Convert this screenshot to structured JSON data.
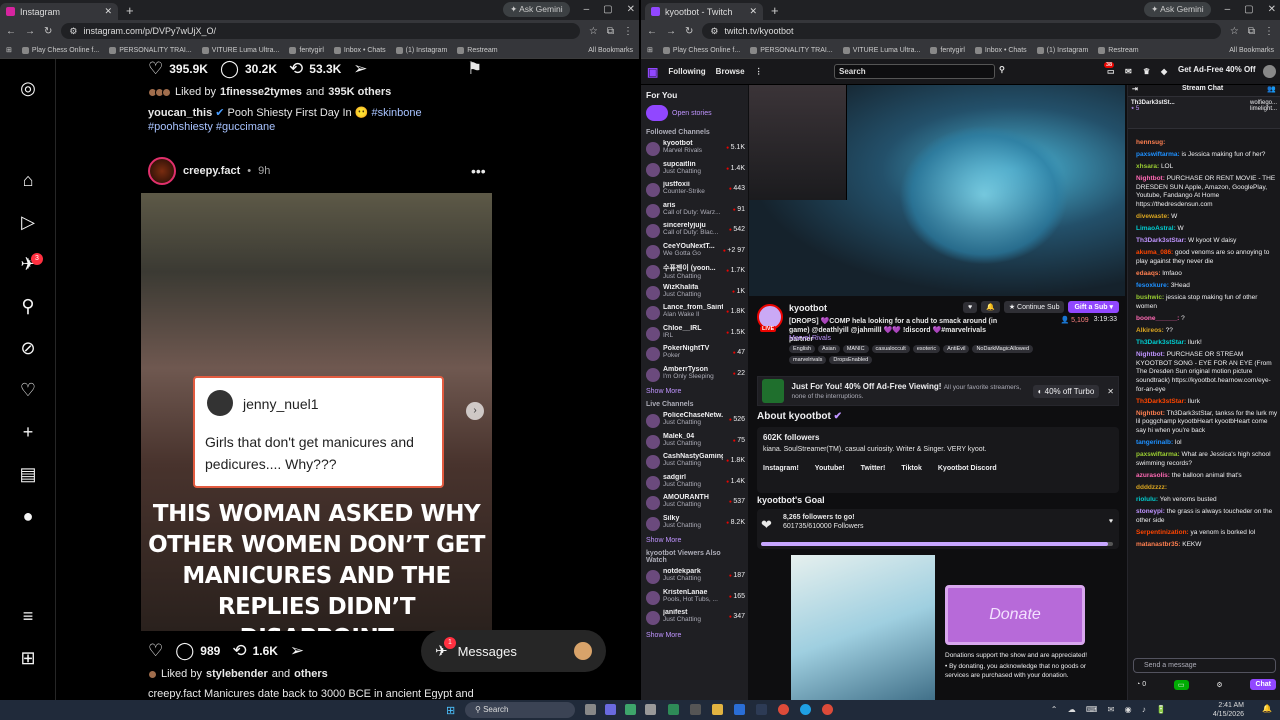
{
  "left": {
    "tab": "Instagram",
    "url": "instagram.com/p/DVPy7wUjX_O/",
    "gemini": "Ask Gemini",
    "bookmarks": [
      "Play Chess Online f...",
      "PERSONALITY TRAI...",
      "VITURE Luma Ultra...",
      "fentygirl",
      "Inbox • Chats",
      "(1) Instagram",
      "Restream"
    ],
    "all_bookmarks": "All Bookmarks",
    "nav_badge": "3",
    "post1": {
      "likes": "395.9K",
      "comments": "30.2K",
      "reposts": "53.3K",
      "liked_by_user": "1finesse2tymes",
      "liked_by_others": "395K others",
      "caption_user": "youcan_this",
      "caption_text": "Pooh Shiesty First Day In",
      "tags": [
        "#skinbone",
        "#poohshiesty",
        "#guccimane"
      ]
    },
    "post2": {
      "user": "creepy.fact",
      "time": "9h",
      "overlay_user": "jenny_nuel1",
      "overlay_text": "Girls that don't get manicures and pedicures.... Why???",
      "headline": "THIS WOMAN ASKED WHY OTHER WOMEN DON’T GET MANICURES AND THE REPLIES DIDN’T DISAPPOINT",
      "comments": "989",
      "reposts": "1.6K",
      "liked_by_user": "stylebender",
      "liked_by_others": "others",
      "caption": "creepy.fact Manicures date back to 3000 BCE in ancient Egypt and"
    },
    "messages_label": "Messages",
    "messages_badge": "1"
  },
  "right": {
    "tab": "kyootbot - Twitch",
    "url": "twitch.tv/kyootbot",
    "gemini": "Ask Gemini",
    "bookmarks": [
      "Play Chess Online f...",
      "PERSONALITY TRAI...",
      "VITURE Luma Ultra...",
      "fentygirl",
      "Inbox • Chats",
      "(1) Instagram",
      "Restream"
    ],
    "all_bookmarks": "All Bookmarks",
    "nav": {
      "following": "Following",
      "browse": "Browse",
      "search_placeholder": "Search",
      "notif": "38",
      "get_ad_free": "Get Ad-Free 40% Off"
    },
    "sidebar": {
      "for_you": "For You",
      "open_stories": "Open stories",
      "followed_title": "Followed Channels",
      "followed": [
        {
          "name": "kyootbot",
          "game": "Marvel Rivals",
          "viewers": "5.1K"
        },
        {
          "name": "supcaitlin",
          "game": "Just Chatting",
          "viewers": "1.4K"
        },
        {
          "name": "justfoxii",
          "game": "Counter-Strike",
          "viewers": "443"
        },
        {
          "name": "aris",
          "game": "Call of Duty: Warz...",
          "viewers": "91"
        },
        {
          "name": "sincerelyjuju",
          "game": "Call of Duty: Blac...",
          "viewers": "542"
        },
        {
          "name": "CeeYOuNextT...",
          "game": "We Gotta Go",
          "viewers": "+2 97"
        },
        {
          "name": "수퓨젠이 (yoon...",
          "game": "Just Chatting",
          "viewers": "1.7K"
        },
        {
          "name": "WizKhalifa",
          "game": "Just Chatting",
          "viewers": "1K"
        },
        {
          "name": "Lance_from_Saints",
          "game": "Alan Wake II",
          "viewers": "1.8K"
        },
        {
          "name": "Chloe__IRL",
          "game": "IRL",
          "viewers": "1.5K"
        },
        {
          "name": "PokerNightTV",
          "game": "Poker",
          "viewers": "47"
        },
        {
          "name": "AmberrTyson",
          "game": "I'm Only Sleeping",
          "viewers": "22"
        }
      ],
      "show_more": "Show More",
      "live_title": "Live Channels",
      "live": [
        {
          "name": "PoliceChaseNetw...",
          "game": "Just Chatting",
          "viewers": "526"
        },
        {
          "name": "Malek_04",
          "game": "Just Chatting",
          "viewers": "75"
        },
        {
          "name": "CashNastyGaming",
          "game": "Just Chatting",
          "viewers": "1.8K"
        },
        {
          "name": "sadgirl",
          "game": "Just Chatting",
          "viewers": "1.4K"
        },
        {
          "name": "AMOURANTH",
          "game": "Just Chatting",
          "viewers": "537"
        },
        {
          "name": "Silky",
          "game": "Just Chatting",
          "viewers": "8.2K"
        }
      ],
      "also_title": "kyootbot Viewers Also Watch",
      "also": [
        {
          "name": "notdekpark",
          "game": "Just Chatting",
          "viewers": "187"
        },
        {
          "name": "KristenLanae",
          "game": "Pools, Hot Tubs, ...",
          "viewers": "165"
        },
        {
          "name": "janifest",
          "game": "Just Chatting",
          "viewers": "347"
        }
      ]
    },
    "stream": {
      "live": "LIVE",
      "name": "kyootbot",
      "title": "[DROPS] 💜COMP hela looking for a chud to smack around (in game) @deathlyill @jahmilll 💜💜 !discord 💜#marvelrivals partner",
      "game": "Marvel Rivals",
      "tags": [
        "English",
        "Asian",
        "MANIC",
        "casualoccult",
        "esoteric",
        "AntiEvil",
        "NoDarkMagicAllowed",
        "marvelrivals",
        "DropsEnabled"
      ],
      "continue_sub": "Continue Sub",
      "gift_sub": "Gift a Sub",
      "viewers": "5,109",
      "uptime": "3:19:33",
      "promo_title": "Just For You! 40% Off Ad-Free Viewing!",
      "promo_sub": "All your favorite streamers, none of the interruptions.",
      "promo_btn": "40% off Turbo",
      "about_title": "About kyootbot",
      "followers": "602K followers",
      "bio": "kiana. SoulStreamer(TM). casual curiosity. Writer & Singer. VERY kyoot.",
      "socials": [
        "Instagram!",
        "Youtube!",
        "Twitter!",
        "Tiktok",
        "Kyootbot Discord"
      ],
      "goal_title": "kyootbot's Goal",
      "goal_line": "8,265 followers to go!",
      "goal_count": "601735/610000 Followers",
      "goal_fraction": 0.9865,
      "donate_label": "Donate",
      "donate_text": "Donations support the show and are appreciated!",
      "donate_bullet": "By donating, you acknowledge that no goods or services are purchased with your donation."
    },
    "chat": {
      "header": "Stream Chat",
      "hype_user": "Th3Dark3stSt...",
      "hype_count": "5",
      "hype_users": [
        "wolfiego...",
        "limelight..."
      ],
      "messages": [
        {
          "user": "hennsug:",
          "text": ""
        },
        {
          "user": "paxswiftarma:",
          "text": "is Jessica making fun of her?"
        },
        {
          "user": "xhsara:",
          "text": "LOL"
        },
        {
          "user": "Nightbot:",
          "text": "PURCHASE OR RENT MOVIE - THE DRESDEN SUN Apple, Amazon, GooglePlay, Youtube, Fandango At Home https://thedresdensun.com"
        },
        {
          "user": "divewaste:",
          "text": "W"
        },
        {
          "user": "LimaoAstral:",
          "text": "W"
        },
        {
          "user": "Th3Dark3stStar:",
          "text": "W kyoot W daisy"
        },
        {
          "user": "akuma_086:",
          "text": "good venoms are so annoying to play against they never die"
        },
        {
          "user": "edaaqs:",
          "text": "lmfaoo"
        },
        {
          "user": "fesoxkure:",
          "text": "3Head"
        },
        {
          "user": "bushwic:",
          "text": "jessica stop making fun of other women"
        },
        {
          "user": "boone______:",
          "text": "?"
        },
        {
          "user": "Alkireos:",
          "text": "??"
        },
        {
          "user": "Th3Dark3stStar:",
          "text": "llurk!"
        },
        {
          "user": "Nightbot:",
          "text": "PURCHASE OR STREAM KYOOTBOT SONG - EYE FOR AN EYE (From The Dresden Sun original motion picture soundtrack) https://kyootbot.hearnow.com/eye-for-an-eye"
        },
        {
          "user": "Th3Dark3stStar:",
          "text": "llurk"
        },
        {
          "user": "Nightbot:",
          "text": "Th3Dark3stStar, tankss for the lurk my lil poggchamp kyootbHeart kyootbHeart come say hi when you're back"
        },
        {
          "user": "tangerinalb:",
          "text": "lol"
        },
        {
          "user": "paxswiftarma:",
          "text": "What are Jessica's high school swimming records?"
        },
        {
          "user": "azurasolis:",
          "text": "the balloon animal that's"
        },
        {
          "user": "ddddzzzz:",
          "text": ""
        },
        {
          "user": "riolulu:",
          "text": "Yeh venoms busted"
        },
        {
          "user": "stoneypi:",
          "text": "the grass is always toucheder on the other side"
        },
        {
          "user": "Serpentinization:",
          "text": "ya venom is borked lol"
        },
        {
          "user": "matanastbr35:",
          "text": "KEKW"
        }
      ],
      "input_placeholder": "Send a message",
      "points": "0",
      "chat_btn": "Chat"
    }
  },
  "taskbar": {
    "search": "Search",
    "time": "2:41 AM",
    "date": "4/15/2026"
  }
}
